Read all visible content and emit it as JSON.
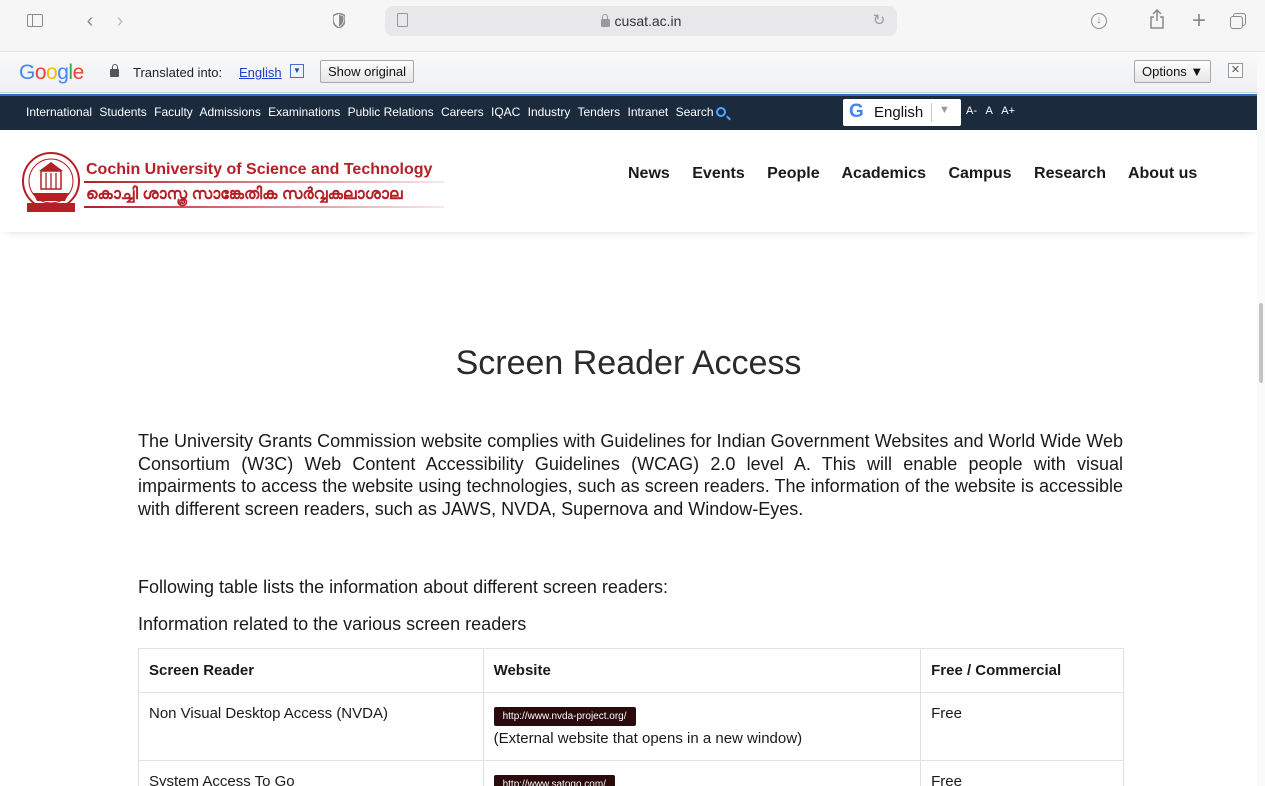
{
  "browser": {
    "url": "cusat.ac.in"
  },
  "translate_bar": {
    "logo": "Google",
    "translated_into": "Translated into:",
    "language": "English",
    "show_original": "Show original",
    "options": "Options ▼",
    "close": "✕"
  },
  "util_nav": {
    "links": [
      "International",
      "Students",
      "Faculty",
      "Admissions",
      "Examinations",
      "Public Relations",
      "Careers",
      "IQAC",
      "Industry",
      "Tenders",
      "Intranet",
      "Search"
    ],
    "translate_language": "English",
    "font_sizes": [
      "A-",
      "A",
      "A+"
    ]
  },
  "header": {
    "name_en": "Cochin University of Science and Technology",
    "name_ml": "കൊച്ചി ശാസ്ത്ര സാങ്കേതിക സർവ്വകലാശാല",
    "nav": [
      "News",
      "Events",
      "People",
      "Academics",
      "Campus",
      "Research",
      "About us"
    ]
  },
  "content": {
    "title": "Screen Reader Access",
    "intro": "The University Grants Commission website complies with Guidelines for Indian Government Websites and World Wide Web Consortium (W3C) Web Content Accessibility Guidelines (WCAG) 2.0 level A. This will enable people with visual impairments to access the website using technologies, such as screen readers. The information of the website is accessible with different screen readers, such as JAWS, NVDA, Supernova and Window-Eyes.",
    "lead1": "Following table lists the information about different screen readers:",
    "lead2": "Information related to the various screen readers",
    "table": {
      "headers": [
        "Screen Reader",
        "Website",
        "Free / Commercial"
      ],
      "rows": [
        {
          "reader": "Non Visual Desktop Access (NVDA)",
          "url": "http://www.nvda-project.org/",
          "note": "(External website that opens in a new window)",
          "type": "Free"
        },
        {
          "reader": "System Access To Go",
          "url": "http://www.satogo.com/",
          "note": "",
          "type": "Free"
        }
      ]
    }
  }
}
